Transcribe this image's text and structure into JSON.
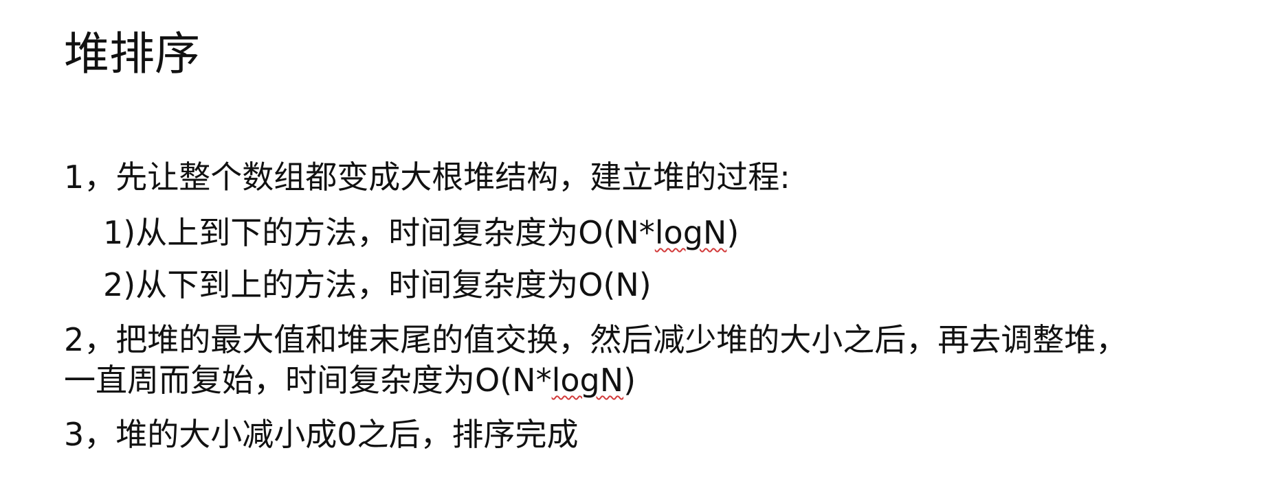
{
  "title": "堆排序",
  "items": [
    {
      "before": "1，先让整个数组都变成大根堆结构，建立堆的过程:",
      "marked": "",
      "after": ""
    },
    {
      "before": "1)从上到下的方法，时间复杂度为O(N*",
      "marked": "logN",
      "after": ")"
    },
    {
      "before": "2)从下到上的方法，时间复杂度为O(N)",
      "marked": "",
      "after": ""
    },
    {
      "before": "2，把堆的最大值和堆末尾的值交换，然后减少堆的大小之后，再去调整堆，",
      "marked": "",
      "after": ""
    },
    {
      "before": "一直周而复始，时间复杂度为O(N*",
      "marked": "logN",
      "after": ")"
    },
    {
      "before": "3，堆的大小减小成0之后，排序完成",
      "marked": "",
      "after": ""
    }
  ]
}
